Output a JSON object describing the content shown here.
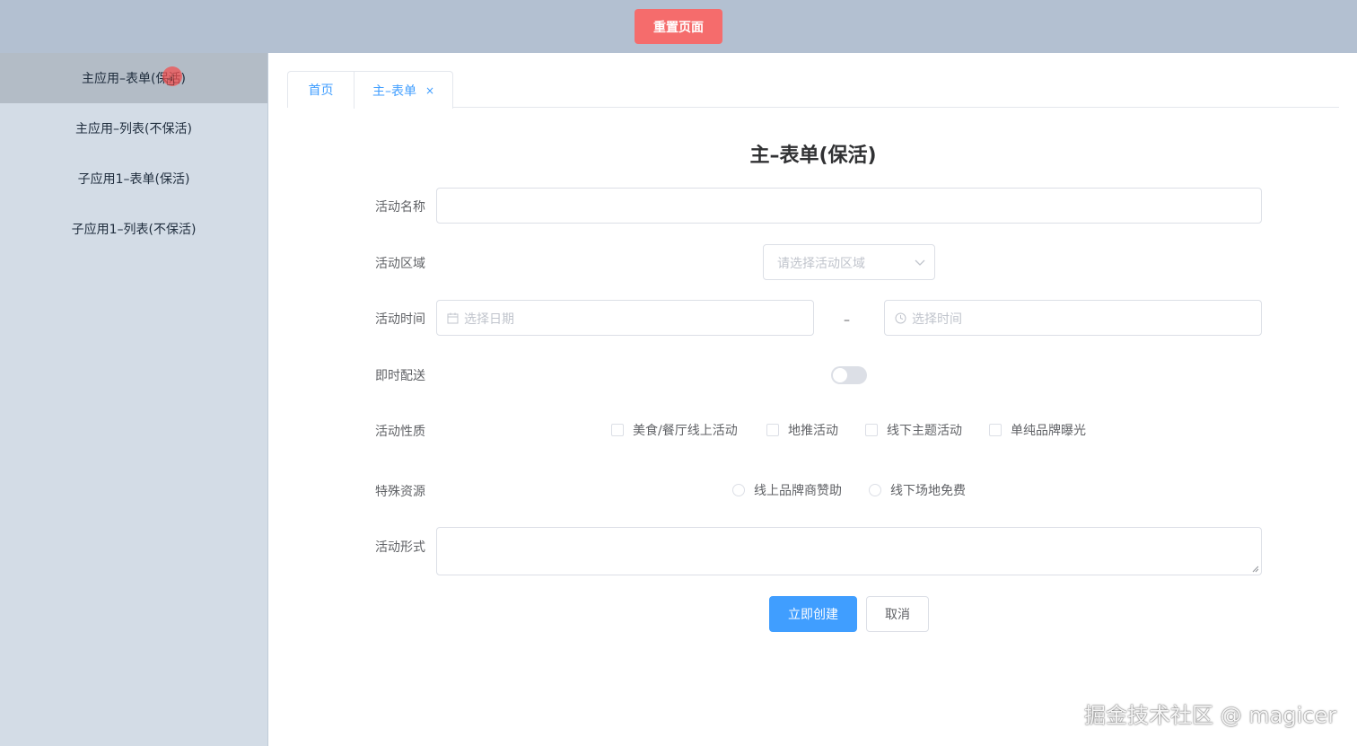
{
  "topbar": {
    "reset_label": "重置页面"
  },
  "sidebar": {
    "items": [
      {
        "label": "主应用–表单(保活)"
      },
      {
        "label": "主应用–列表(不保活)"
      },
      {
        "label": "子应用1–表单(保活)"
      },
      {
        "label": "子应用1–列表(不保活)"
      }
    ]
  },
  "tabs": [
    {
      "label": "首页"
    },
    {
      "label": "主–表单",
      "close": "×"
    }
  ],
  "form": {
    "title": "主–表单(保活)",
    "fields": {
      "name": {
        "label": "活动名称",
        "value": ""
      },
      "region": {
        "label": "活动区域",
        "placeholder": "请选择活动区域"
      },
      "time": {
        "label": "活动时间",
        "date_placeholder": "选择日期",
        "separator": "–",
        "time_placeholder": "选择时间"
      },
      "delivery": {
        "label": "即时配送",
        "on": false
      },
      "type": {
        "label": "活动性质",
        "options": [
          "美食/餐厅线上活动",
          "地推活动",
          "线下主题活动",
          "单纯品牌曝光"
        ]
      },
      "resource": {
        "label": "特殊资源",
        "options": [
          "线上品牌商赞助",
          "线下场地免费"
        ]
      },
      "desc": {
        "label": "活动形式",
        "value": ""
      }
    },
    "buttons": {
      "submit": "立即创建",
      "cancel": "取消"
    }
  },
  "watermark": "掘金技术社区 @ magicer",
  "colors": {
    "header_bg": "#b3c0d1",
    "sidebar_bg": "#d3dce6",
    "danger": "#f56c6c",
    "primary": "#409eff"
  }
}
